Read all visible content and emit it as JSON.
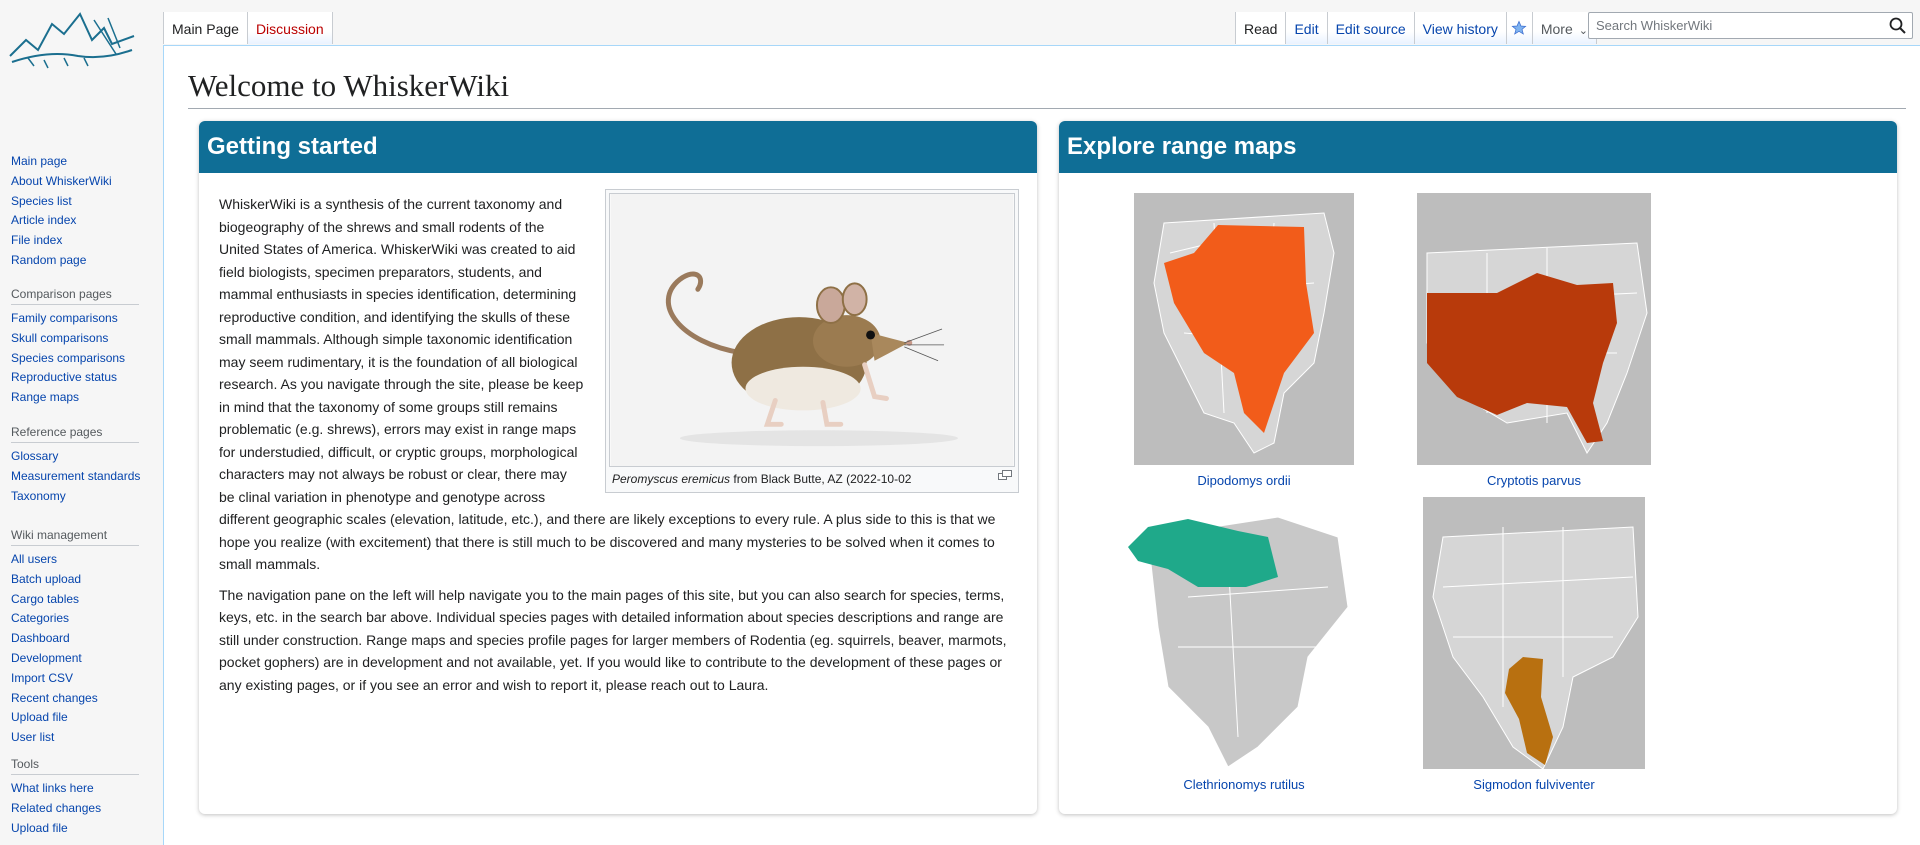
{
  "header": {
    "tabs_left": [
      {
        "label": "Main Page",
        "state": "selected"
      },
      {
        "label": "Discussion",
        "state": "new"
      }
    ],
    "tabs_right": [
      {
        "label": "Read"
      },
      {
        "label": "Edit"
      },
      {
        "label": "Edit source"
      },
      {
        "label": "View history"
      }
    ],
    "more_label": "More",
    "search_placeholder": "Search WhiskerWiki"
  },
  "sidebar": {
    "main": [
      "Main page",
      "About WhiskerWiki",
      "Species list",
      "Article index",
      "File index",
      "Random page"
    ],
    "portals": [
      {
        "heading": "Comparison pages",
        "items": [
          "Family comparisons",
          "Skull comparisons",
          "Species comparisons",
          "Reproductive status",
          "Range maps"
        ]
      },
      {
        "heading": "Reference pages",
        "items": [
          "Glossary",
          "Measurement standards",
          "Taxonomy"
        ]
      },
      {
        "heading": "Wiki management",
        "items": [
          "All users",
          "Batch upload",
          "Cargo tables",
          "Categories",
          "Dashboard",
          "Development",
          "Import CSV",
          "Recent changes",
          "Upload file",
          "User list"
        ]
      },
      {
        "heading": "Tools",
        "items": [
          "What links here",
          "Related changes",
          "Upload file"
        ]
      }
    ]
  },
  "page": {
    "title": "Welcome to WhiskerWiki",
    "getting_started": {
      "heading": "Getting started",
      "paragraph1": "WhiskerWiki is a synthesis of the current taxonomy and biogeography of the shrews and small rodents of the United States of America. WhiskerWiki was created to aid field biologists, specimen preparators, students, and mammal enthusiasts in species identification, determining reproductive condition, and identifying the skulls of these small mammals. Although simple taxonomic identification may seem rudimentary, it is the foundation of all biological research. As you navigate through the site, please be keep in mind that the taxonomy of some groups still remains problematic (e.g. shrews), errors may exist in range maps for understudied, difficult, or cryptic groups, morphological characters may not always be robust or clear, there may be clinal variation in phenotype and genotype across different geographic scales (elevation, latitude, etc.), and there are likely exceptions to every rule. A plus side to this is that we hope you realize (with excitement) that there is still much to be discovered and many mysteries to be solved when it comes to small mammals.",
      "paragraph2": "The navigation pane on the left will help navigate you to the main pages of this site, but you can also search for species, terms, keys, etc. in the search bar above. Individual species pages with detailed information about species descriptions and range are still under construction. Range maps and species profile pages for larger members of Rodentia (eg. squirrels, beaver, marmots, pocket gophers) are in development and not available, yet. If you would like to contribute to the development of these pages or any existing pages, or if you see an error and wish to report it, please reach out to Laura.",
      "image_caption_species": "Peromyscus eremicus",
      "image_caption_rest": " from Black Butte, AZ (2022-10-02"
    },
    "range_maps": {
      "heading": "Explore range maps",
      "maps": [
        {
          "species": "Dipodomys ordii",
          "color": "#f25c1a"
        },
        {
          "species": "Cryptotis parvus",
          "color": "#b83a0b"
        },
        {
          "species": "Clethrionomys rutilus",
          "color": "#1fa98a"
        },
        {
          "species": "Sigmodon fulviventer",
          "color": "#b87010"
        }
      ]
    }
  },
  "colors": {
    "header_blue": "#0f6e96",
    "link": "#0645ad",
    "new_link": "#ba0000",
    "map_land": "#cfcfcf"
  }
}
